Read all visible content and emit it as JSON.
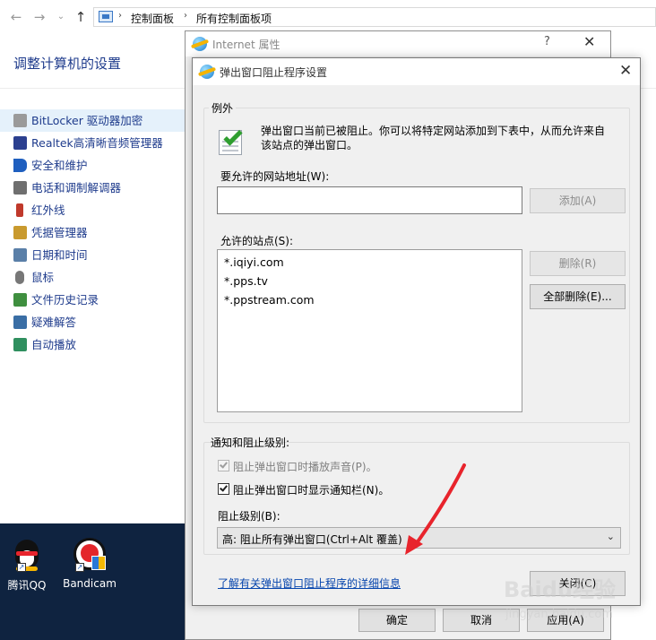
{
  "control_panel": {
    "breadcrumb": [
      "控制面板",
      "所有控制面板项"
    ],
    "title": "调整计算机的设置",
    "items": [
      {
        "label": "BitLocker 驱动器加密",
        "icon": "bitlocker-icon",
        "color": "#8a8a8a"
      },
      {
        "label": "Realtek高清晰音频管理器",
        "icon": "audio-manager-icon",
        "color": "#2b3f8f"
      },
      {
        "label": "安全和维护",
        "icon": "flag-icon",
        "color": "#1f5fbf"
      },
      {
        "label": "电话和调制解调器",
        "icon": "fax-icon",
        "color": "#6f6f6f"
      },
      {
        "label": "红外线",
        "icon": "infrared-icon",
        "color": "#c0392b"
      },
      {
        "label": "凭据管理器",
        "icon": "credential-icon",
        "color": "#c99a2e"
      },
      {
        "label": "日期和时间",
        "icon": "clock-icon",
        "color": "#5a7fa8"
      },
      {
        "label": "鼠标",
        "icon": "mouse-icon",
        "color": "#777777"
      },
      {
        "label": "文件历史记录",
        "icon": "file-history-icon",
        "color": "#3f8f3f"
      },
      {
        "label": "疑难解答",
        "icon": "troubleshoot-icon",
        "color": "#3a6ea5"
      },
      {
        "label": "自动播放",
        "icon": "autoplay-icon",
        "color": "#2f8f5f"
      }
    ]
  },
  "desktop": {
    "icons": [
      {
        "label": "腾讯QQ",
        "icon": "qq-icon"
      },
      {
        "label": "Bandicam",
        "icon": "bandicam-icon"
      }
    ]
  },
  "internet_properties": {
    "title": "Internet 属性",
    "help": "?",
    "close": "✕",
    "ok": "确定",
    "cancel": "取消",
    "apply": "应用(A)"
  },
  "popup_dialog": {
    "title": "弹出窗口阻止程序设置",
    "close": "✕",
    "exceptions_group": "例外",
    "info_line1": "弹出窗口当前已被阻止。你可以将特定网站添加到下表中，从而允许来自",
    "info_line2": "该站点的弹出窗口。",
    "address_label": "要允许的网站地址(W):",
    "address_value": "",
    "add_button": "添加(A)",
    "allowed_label": "允许的站点(S):",
    "allowed_sites": [
      "*.iqiyi.com",
      "*.pps.tv",
      "*.ppstream.com"
    ],
    "remove_button": "删除(R)",
    "remove_all_button": "全部删除(E)...",
    "notify_group": "通知和阻止级别:",
    "sound_checkbox": {
      "label": "阻止弹出窗口时播放声音(P)。",
      "checked": true,
      "disabled": true
    },
    "bar_checkbox": {
      "label": "阻止弹出窗口时显示通知栏(N)。",
      "checked": true,
      "disabled": false
    },
    "level_label": "阻止级别(B):",
    "level_value": "高: 阻止所有弹出窗口(Ctrl+Alt 覆盖)",
    "learn_more_link": "了解有关弹出窗口阻止程序的详细信息",
    "close_button": "关闭(C)"
  },
  "watermark": {
    "brand": "Baidu经验",
    "url": "jingyan.baidu.com"
  },
  "colors": {
    "link": "#0645ad",
    "cp_text": "#1e3b8c",
    "annotation_arrow": "#e8242c",
    "desktop_bg": "#0f2340"
  }
}
